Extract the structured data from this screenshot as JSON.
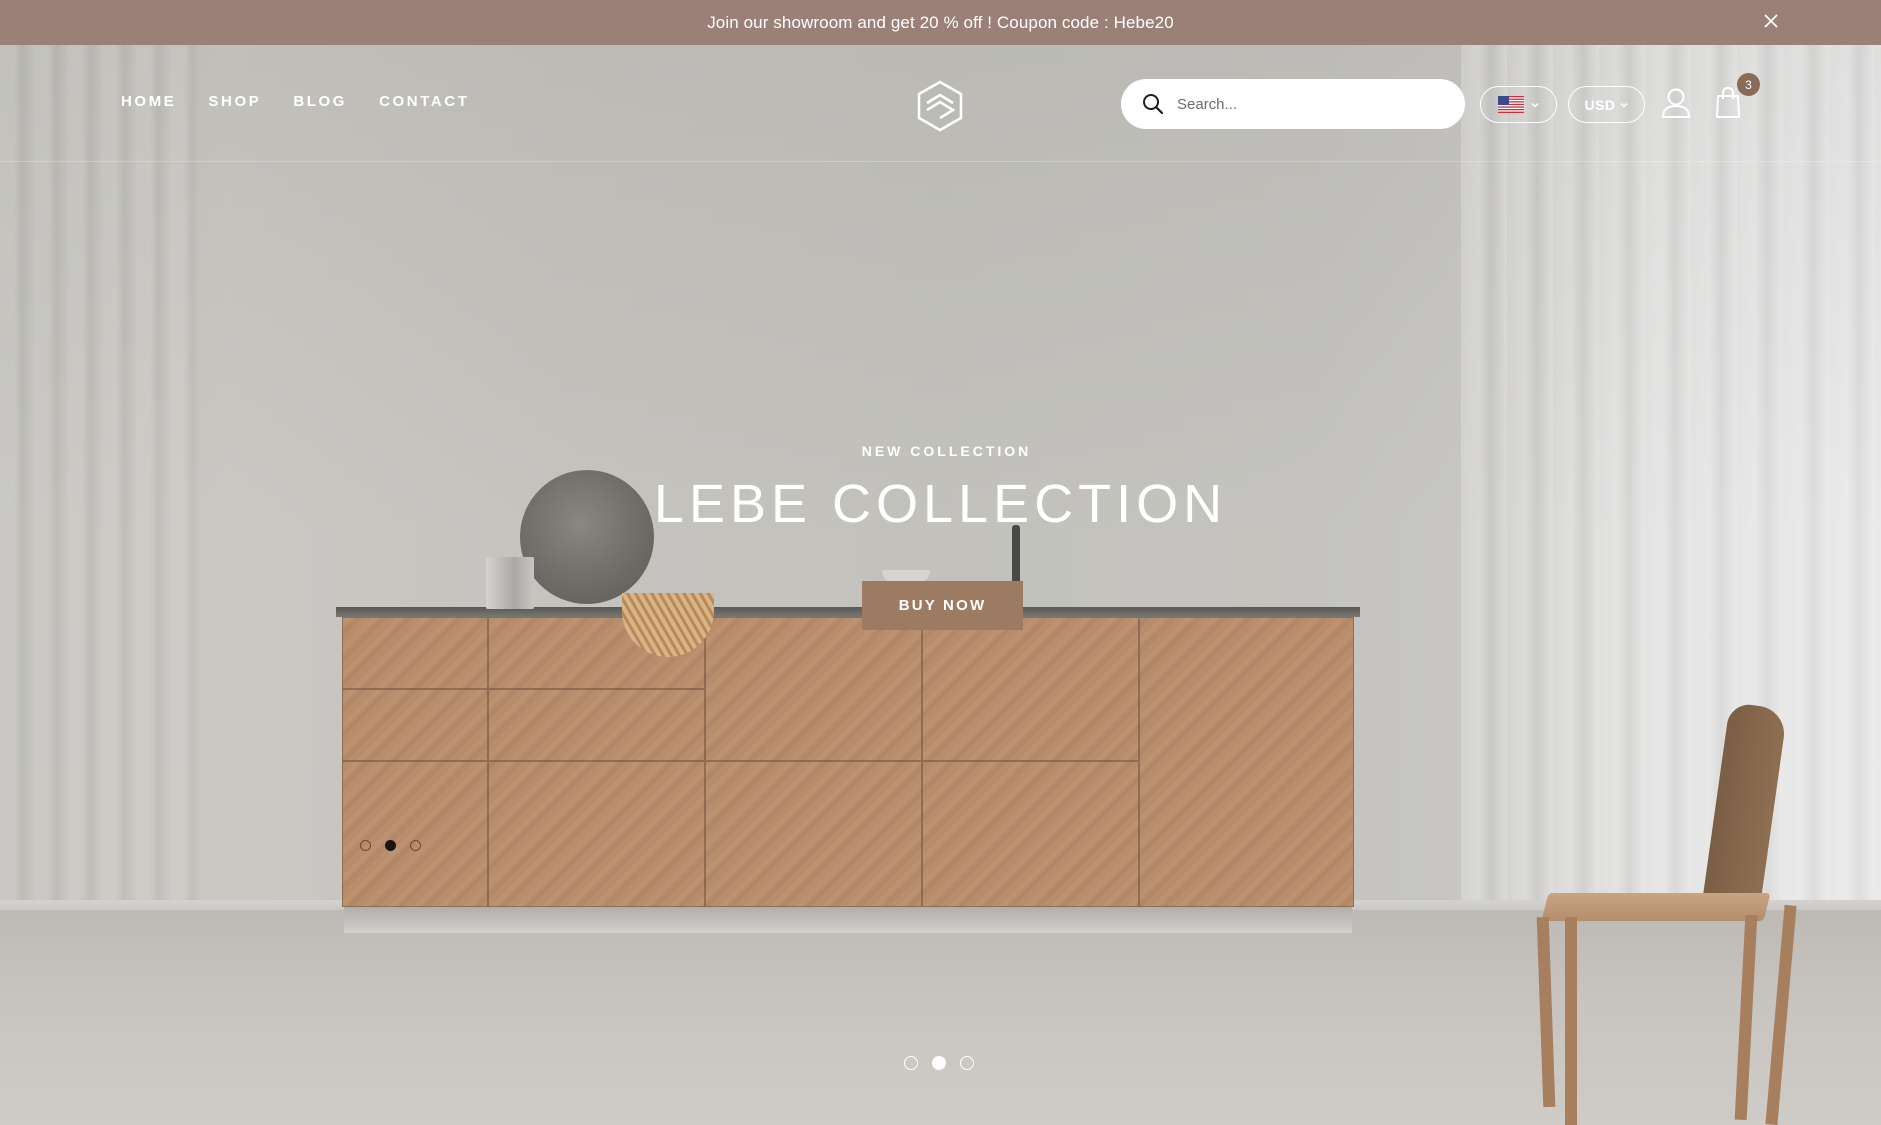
{
  "announcement": {
    "text": "Join our showroom and get 20 % off ! Coupon code : Hebe20",
    "close_icon": "close-icon"
  },
  "header": {
    "nav": [
      "HOME",
      "SHOP",
      "BLOG",
      "CONTACT"
    ],
    "logo_icon": "brand-logo-icon",
    "search": {
      "placeholder": "Search...",
      "value": "",
      "icon": "search-icon"
    },
    "language": {
      "flag_icon": "us-flag-icon"
    },
    "currency": {
      "label": "USD"
    },
    "account_icon": "user-icon",
    "cart": {
      "icon": "shopping-bag-icon",
      "count": "3"
    }
  },
  "hero": {
    "eyebrow": "NEW COLLECTION",
    "headline": "LEBE COLLECTION",
    "cta_label": "BUY NOW",
    "slides_total": 3,
    "active_slide": 2
  },
  "colors": {
    "announcement_bg": "#9a8077",
    "cta_bg": "#9d7b62",
    "badge_bg": "#8a6a58",
    "text_light": "#ffffff"
  }
}
